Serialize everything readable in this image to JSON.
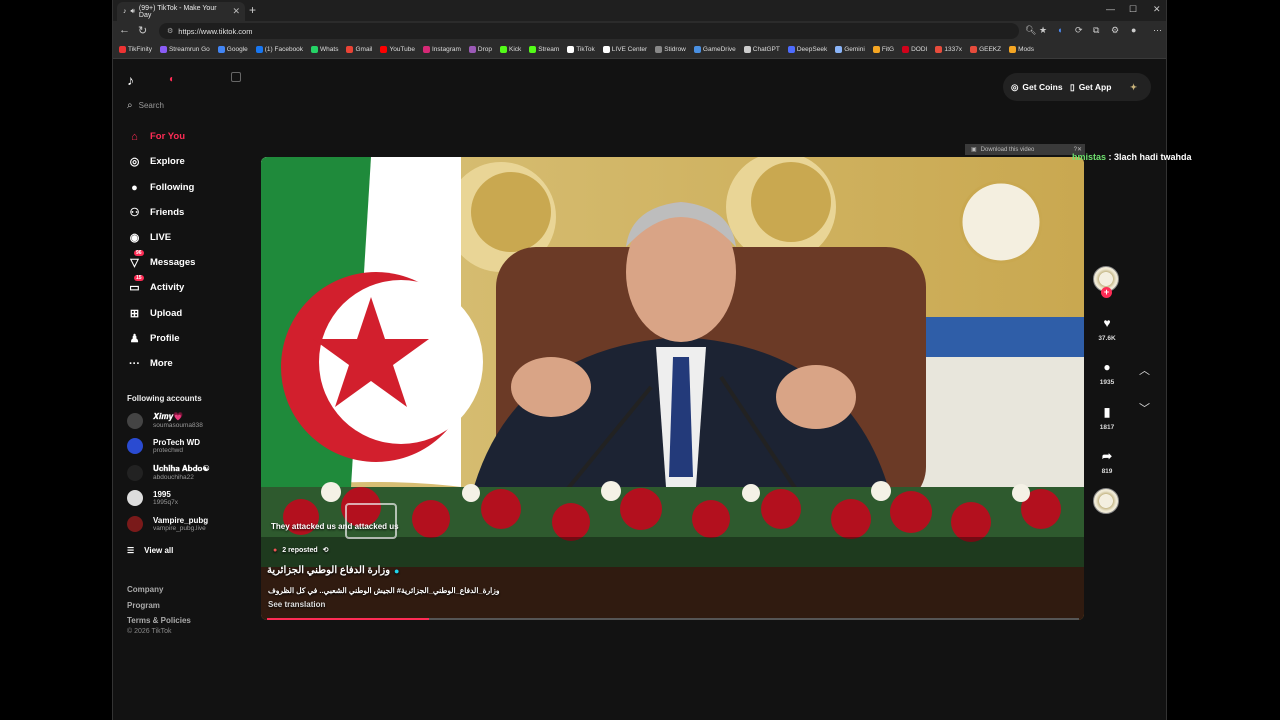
{
  "browser": {
    "tab_title": "(99+) TikTok - Make Your Day",
    "url": "https://www.tiktok.com",
    "bookmarks": [
      {
        "label": "TikFinity",
        "color": "#e33"
      },
      {
        "label": "Streamrun Go",
        "color": "#8a5cf6"
      },
      {
        "label": "Google",
        "color": "#4285f4"
      },
      {
        "label": "(1) Facebook",
        "color": "#1877f2"
      },
      {
        "label": "Whats",
        "color": "#25d366"
      },
      {
        "label": "Gmail",
        "color": "#ea4335"
      },
      {
        "label": "YouTube",
        "color": "#ff0000"
      },
      {
        "label": "Instagram",
        "color": "#d62976"
      },
      {
        "label": "Drop",
        "color": "#9b59b6"
      },
      {
        "label": "Kick",
        "color": "#53fc18"
      },
      {
        "label": "Stream",
        "color": "#53fc18"
      },
      {
        "label": "TikTok",
        "color": "#ffffff"
      },
      {
        "label": "LIVE Center",
        "color": "#ffffff"
      },
      {
        "label": "Stidrow",
        "color": "#888888"
      },
      {
        "label": "GameDrive",
        "color": "#4a90e2"
      },
      {
        "label": "ChatGPT",
        "color": "#cccccc"
      },
      {
        "label": "DeepSeek",
        "color": "#4d6bfe"
      },
      {
        "label": "Gemini",
        "color": "#8ab4f8"
      },
      {
        "label": "FitG",
        "color": "#f5a623"
      },
      {
        "label": "DODI",
        "color": "#d0021b"
      },
      {
        "label": "1337x",
        "color": "#e74c3c"
      },
      {
        "label": "GEEKZ",
        "color": "#e74c3c"
      },
      {
        "label": "Mods",
        "color": "#f5a623"
      }
    ]
  },
  "sidebar": {
    "search_placeholder": "Search",
    "nav": [
      {
        "label": "For You",
        "icon": "home-icon",
        "glyph": "⌂",
        "active": true
      },
      {
        "label": "Explore",
        "icon": "compass-icon",
        "glyph": "◎"
      },
      {
        "label": "Following",
        "icon": "following-avatar-icon",
        "glyph": "●"
      },
      {
        "label": "Friends",
        "icon": "friends-icon",
        "glyph": "⚇"
      },
      {
        "label": "LIVE",
        "icon": "live-icon",
        "glyph": "◉"
      },
      {
        "label": "Messages",
        "icon": "messages-icon",
        "glyph": "▽",
        "badge": "96"
      },
      {
        "label": "Activity",
        "icon": "activity-icon",
        "glyph": "▭",
        "badge": "15"
      },
      {
        "label": "Upload",
        "icon": "upload-icon",
        "glyph": "⊞"
      },
      {
        "label": "Profile",
        "icon": "profile-icon",
        "glyph": "♟"
      },
      {
        "label": "More",
        "icon": "more-icon",
        "glyph": "···"
      }
    ],
    "following_title": "Following accounts",
    "accounts": [
      {
        "name": "𝑿𝒊𝒎𝒚💗",
        "username": "soumasouma838",
        "color": "#444"
      },
      {
        "name": "ProTech WD",
        "username": "protechwd",
        "color": "#2a4bd1"
      },
      {
        "name": "𝐔𝐜𝐡𝐢𝐡𝐚 𝐀𝐛𝐝𝐨☯",
        "username": "abdouchiha22",
        "color": "#222"
      },
      {
        "name": "1995",
        "username": "1995q7x",
        "color": "#ddd"
      },
      {
        "name": "Vampire_pubg",
        "username": "vampire_pubg.live",
        "color": "#7a1a1a"
      }
    ],
    "view_all": "View all",
    "footer": [
      "Company",
      "Program",
      "Terms & Policies"
    ],
    "copyright": "© 2026 TikTok"
  },
  "header": {
    "get_coins": "Get Coins",
    "get_app": "Get App"
  },
  "video": {
    "download_banner": "Download this video",
    "caption_overlay": "They attacked us and attacked us",
    "reposted": "2 reposted",
    "author": "وزارة الدفاع الوطني الجزائرية",
    "description": "وزارة_الدفاع_الوطني_الجزائرية# الجيش الوطني الشعبي.. في كل الظروف",
    "see_translation": "See translation",
    "progress": 0.2
  },
  "chat": {
    "user": "hmistas",
    "message": " : 3lach hadi twahda"
  },
  "actions": {
    "likes": "37.6K",
    "comments": "1935",
    "saves": "1817",
    "shares": "819"
  }
}
